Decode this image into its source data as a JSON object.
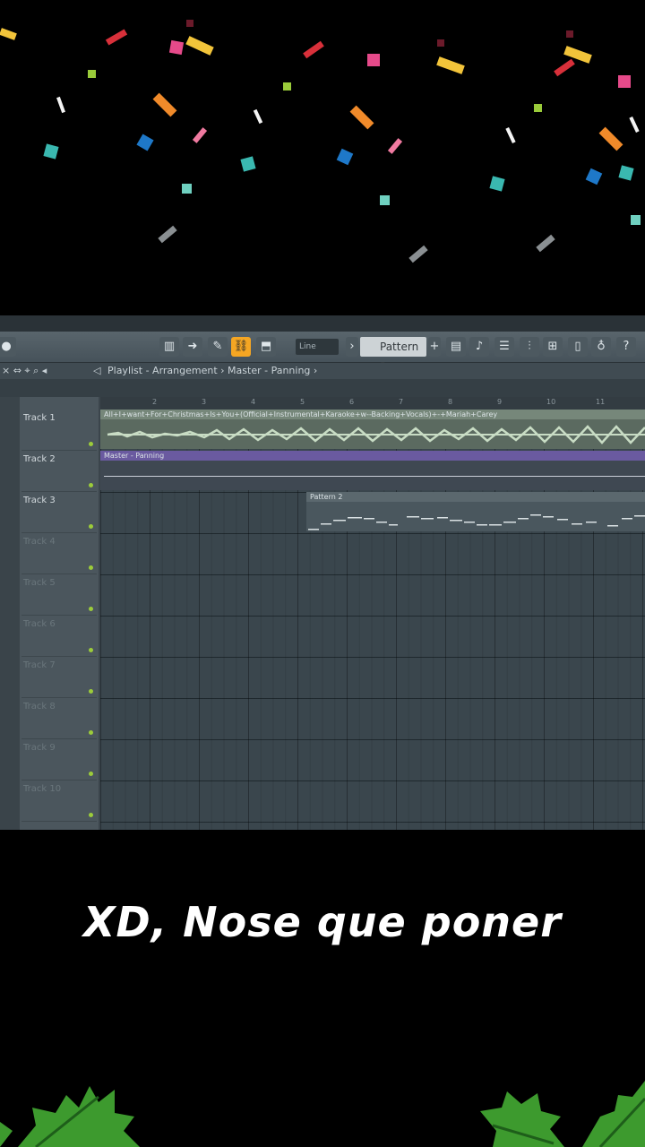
{
  "toolbar": {
    "line_mode": "Line",
    "pattern": "Pattern 2"
  },
  "titlebar": {
    "title": "Playlist - Arrangement › Master - Panning ›"
  },
  "ruler": {
    "bars": [
      "2",
      "3",
      "4",
      "5",
      "6",
      "7",
      "8",
      "9",
      "10",
      "11"
    ]
  },
  "tracks": [
    {
      "label": "Track 1",
      "dim": false
    },
    {
      "label": "Track 2",
      "dim": false
    },
    {
      "label": "Track 3",
      "dim": false
    },
    {
      "label": "Track 4",
      "dim": true
    },
    {
      "label": "Track 5",
      "dim": true
    },
    {
      "label": "Track 6",
      "dim": true
    },
    {
      "label": "Track 7",
      "dim": true
    },
    {
      "label": "Track 8",
      "dim": true
    },
    {
      "label": "Track 9",
      "dim": true
    },
    {
      "label": "Track 10",
      "dim": true
    }
  ],
  "clips": {
    "audio": "All+I+want+For+Christmas+Is+You+(Official+Instrumental+Karaoke+w--Backing+Vocals)+-+Mariah+Carey",
    "automation": "Master - Panning",
    "pattern": "Pattern 2"
  },
  "caption": "XD, Nose que poner",
  "colors": {
    "accent": "#f5a623",
    "track_dot": "#9ccc3a",
    "holly": "#3d9a2e"
  }
}
